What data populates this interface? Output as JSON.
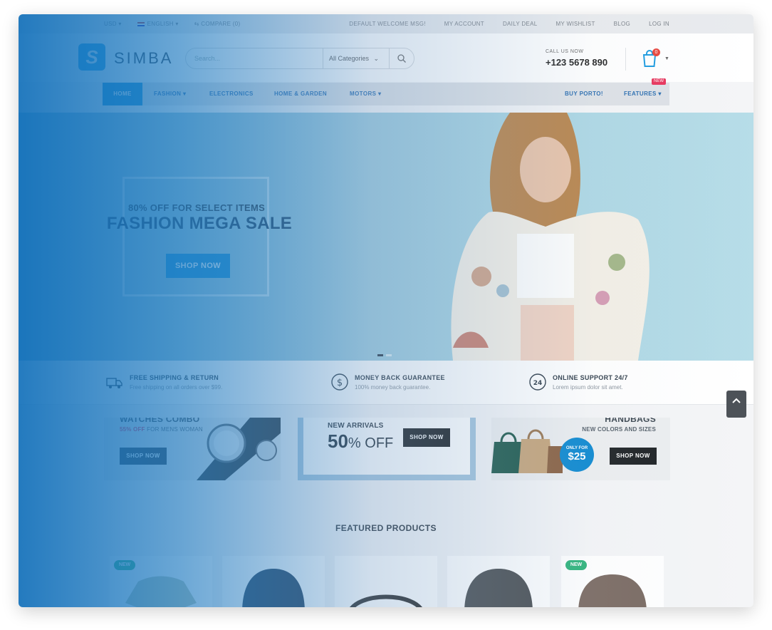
{
  "topbar": {
    "currency": "USD",
    "language": "ENGLISH",
    "compare": "COMPARE (0)",
    "links": [
      "DEFAULT WELCOME MSG!",
      "MY ACCOUNT",
      "DAILY DEAL",
      "MY WISHLIST",
      "BLOG",
      "LOG IN"
    ]
  },
  "header": {
    "logo_letter": "S",
    "logo_text": "SIMBA",
    "search_placeholder": "Search...",
    "category": "All Categories",
    "call_label": "CALL US NOW",
    "phone": "+123 5678 890",
    "cart_count": "0"
  },
  "nav": {
    "items": [
      "HOME",
      "FASHION",
      "ELECTRONICS",
      "HOME & GARDEN",
      "MOTORS"
    ],
    "right": [
      "BUY PORTO!",
      "FEATURES"
    ],
    "new_tag": "NEW"
  },
  "hero": {
    "subtitle": "80% OFF FOR SELECT ITEMS",
    "title": "FASHION MEGA SALE",
    "button": "SHOP NOW"
  },
  "features": [
    {
      "title": "FREE SHIPPING & RETURN",
      "text": "Free shipping on all orders over $99.",
      "icon": "truck-icon"
    },
    {
      "title": "MONEY BACK GUARANTEE",
      "text": "100% money back guarantee.",
      "icon": "dollar-icon"
    },
    {
      "title": "ONLINE SUPPORT 24/7",
      "text": "Lorem ipsum dolor sit amet.",
      "icon": "support-24-icon"
    }
  ],
  "banners": {
    "watches": {
      "title": "WATCHES COMBO",
      "sub_pct": "55% OFF",
      "sub_rest": "FOR MENS WOMAN",
      "button": "SHOP NOW"
    },
    "arrivals": {
      "label": "NEW ARRIVALS",
      "pct": "50",
      "off": "% OFF",
      "button": "SHOP NOW"
    },
    "handbags": {
      "title": "HANDBAGS",
      "sub": "NEW COLORS AND SIZES",
      "only_for": "ONLY FOR",
      "price": "$25",
      "button": "SHOP NOW"
    }
  },
  "featured": {
    "heading": "FEATURED PRODUCTS",
    "cards": [
      {
        "tag": "NEW"
      },
      {
        "tag": ""
      },
      {
        "tag": ""
      },
      {
        "tag": ""
      },
      {
        "tag": "NEW"
      }
    ]
  },
  "colors": {
    "accent": "#0b88d0",
    "new_badge": "#2db37a",
    "cart_badge": "#e8453c"
  }
}
